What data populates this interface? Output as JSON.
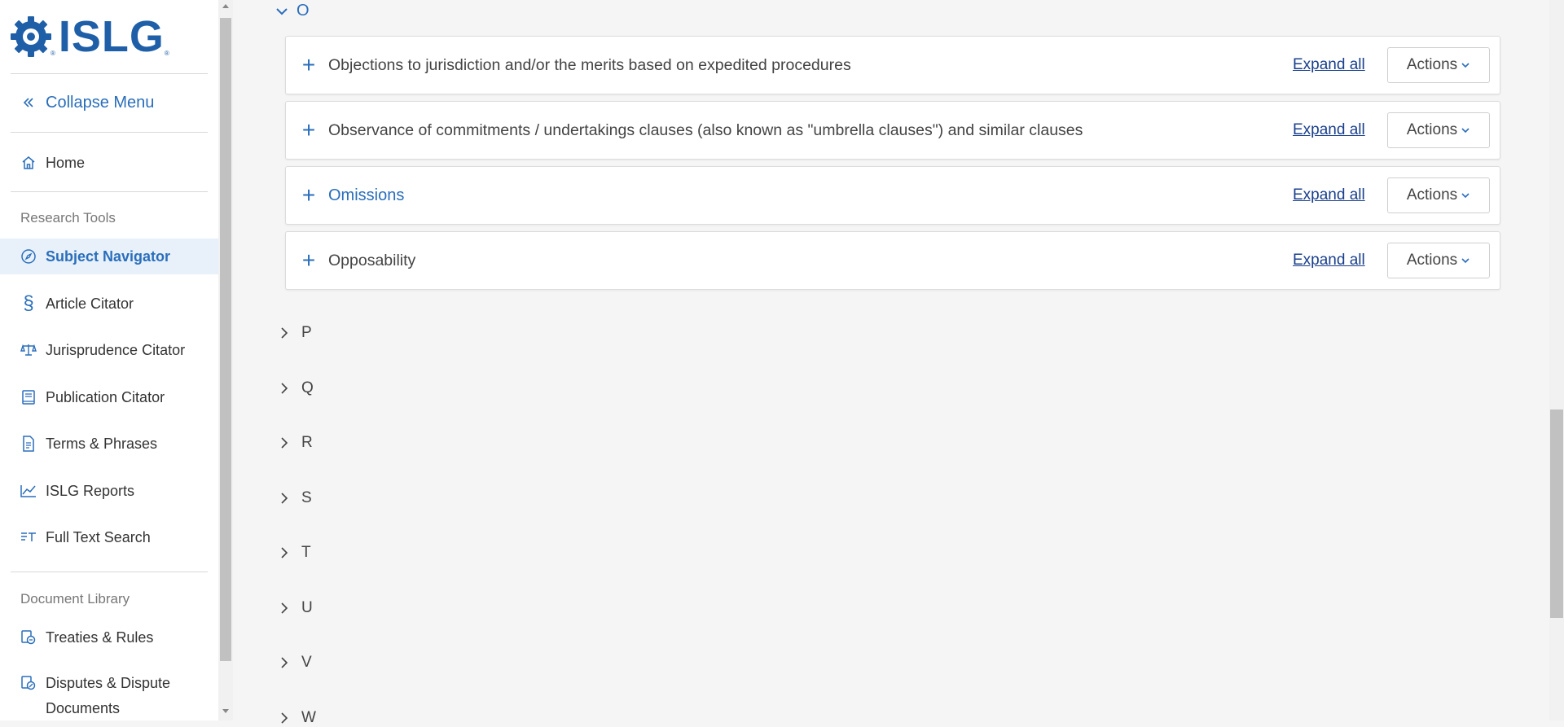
{
  "brand": {
    "logo_text": "ISLG",
    "reg_mark": "®"
  },
  "sidebar": {
    "collapse_label": "Collapse Menu",
    "home_label": "Home",
    "research_tools_heading": "Research Tools",
    "research_items": [
      {
        "label": "Subject Navigator",
        "icon": "compass-icon",
        "active": true
      },
      {
        "label": "Article Citator",
        "icon": "section-icon",
        "active": false
      },
      {
        "label": "Jurisprudence Citator",
        "icon": "scales-icon",
        "active": false
      },
      {
        "label": "Publication Citator",
        "icon": "book-icon",
        "active": false
      },
      {
        "label": "Terms & Phrases",
        "icon": "document-icon",
        "active": false
      },
      {
        "label": "ISLG Reports",
        "icon": "chart-line-icon",
        "active": false
      },
      {
        "label": "Full Text Search",
        "icon": "text-search-icon",
        "active": false
      }
    ],
    "document_library_heading": "Document Library",
    "library_items": [
      {
        "label": "Treaties & Rules",
        "icon": "treaty-icon"
      },
      {
        "label": "Disputes & Dispute",
        "label2": "Documents",
        "icon": "dispute-icon"
      }
    ]
  },
  "main": {
    "current_letter": "O",
    "entries": [
      {
        "title": "Objections to jurisdiction and/or the merits based on expedited procedures",
        "link": false,
        "expand_label": "Expand all",
        "actions_label": "Actions"
      },
      {
        "title": "Observance of commitments / undertakings clauses (also known as \"umbrella clauses\") and similar clauses",
        "link": false,
        "expand_label": "Expand all",
        "actions_label": "Actions"
      },
      {
        "title": "Omissions",
        "link": true,
        "expand_label": "Expand all",
        "actions_label": "Actions"
      },
      {
        "title": "Opposability",
        "link": false,
        "expand_label": "Expand all",
        "actions_label": "Actions"
      }
    ],
    "letters": [
      "P",
      "Q",
      "R",
      "S",
      "T",
      "U",
      "V",
      "W"
    ]
  },
  "colors": {
    "accent": "#2a6ebb",
    "link_dark": "#1a3f8c",
    "active_bg": "#e8f1fa"
  }
}
